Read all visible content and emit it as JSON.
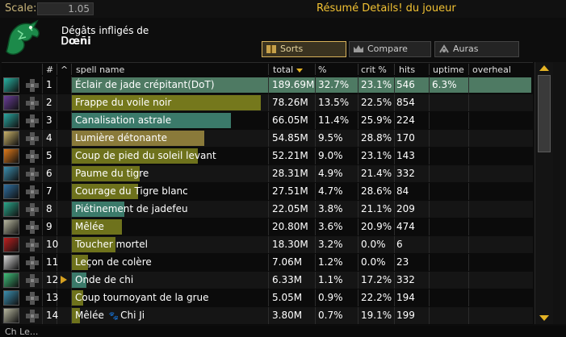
{
  "topbar": {
    "scale_label": "Scale:",
    "scale_value": "1.05",
    "title": "Résumé Details! du joueur"
  },
  "header": {
    "damage_label": "Dégâts infligés de",
    "player_name": "Ꭰœñi"
  },
  "tabs": [
    {
      "label": "Sorts",
      "active": true
    },
    {
      "label": "Compare",
      "active": false
    },
    {
      "label": "Auras",
      "active": false
    }
  ],
  "columns": {
    "num": "#",
    "sort": "^",
    "spell": "spell name",
    "total": "total",
    "pct": "%",
    "crit": "crit %",
    "hits": "hits",
    "uptime": "uptime",
    "overheal": "overheal"
  },
  "rows": [
    {
      "rank": "1",
      "name": "Éclair de jade crépitant(DoT)",
      "total": "189.69M",
      "pct": "32.7%",
      "crit": "23.1%",
      "hits": "546",
      "uptime": "6.3%",
      "bar_fraction": 1.0,
      "bar_color": "#4e7a63",
      "icon_color": "#27b3a3",
      "expandable": false,
      "pet": ""
    },
    {
      "rank": "2",
      "name": "Frappe du voile noir",
      "total": "78.26M",
      "pct": "13.5%",
      "crit": "22.5%",
      "hits": "854",
      "uptime": "",
      "bar_fraction": 0.413,
      "bar_color": "#75781c",
      "icon_color": "#6b3e9a",
      "expandable": false,
      "pet": ""
    },
    {
      "rank": "3",
      "name": "Canalisation astrale",
      "total": "66.05M",
      "pct": "11.4%",
      "crit": "25.9%",
      "hits": "224",
      "uptime": "",
      "bar_fraction": 0.348,
      "bar_color": "#3b7a6a",
      "icon_color": "#2aa7a0",
      "expandable": false,
      "pet": ""
    },
    {
      "rank": "4",
      "name": "Lumière détonante",
      "total": "54.85M",
      "pct": "9.5%",
      "crit": "28.8%",
      "hits": "170",
      "uptime": "",
      "bar_fraction": 0.289,
      "bar_color": "#8a7a3a",
      "icon_color": "#c9b26a",
      "expandable": false,
      "pet": ""
    },
    {
      "rank": "5",
      "name": "Coup de pied du soleil levant",
      "total": "52.21M",
      "pct": "9.0%",
      "crit": "23.1%",
      "hits": "143",
      "uptime": "",
      "bar_fraction": 0.275,
      "bar_color": "#6e721c",
      "icon_color": "#e07a1a",
      "expandable": false,
      "pet": ""
    },
    {
      "rank": "6",
      "name": "Paume du tigre",
      "total": "28.31M",
      "pct": "4.9%",
      "crit": "21.4%",
      "hits": "332",
      "uptime": "",
      "bar_fraction": 0.149,
      "bar_color": "#6e721c",
      "icon_color": "#3b8fb0",
      "expandable": false,
      "pet": ""
    },
    {
      "rank": "7",
      "name": "Courage du Tigre blanc",
      "total": "27.51M",
      "pct": "4.7%",
      "crit": "28.6%",
      "hits": "84",
      "uptime": "",
      "bar_fraction": 0.145,
      "bar_color": "#6e721c",
      "icon_color": "#2f6fa0",
      "expandable": false,
      "pet": ""
    },
    {
      "rank": "8",
      "name": "Piétinement de jadefeu",
      "total": "22.05M",
      "pct": "3.8%",
      "crit": "21.1%",
      "hits": "209",
      "uptime": "",
      "bar_fraction": 0.116,
      "bar_color": "#3b7a6a",
      "icon_color": "#2aa78a",
      "expandable": false,
      "pet": ""
    },
    {
      "rank": "9",
      "name": "Mêlée",
      "total": "20.80M",
      "pct": "3.6%",
      "crit": "20.9%",
      "hits": "474",
      "uptime": "",
      "bar_fraction": 0.11,
      "bar_color": "#6e721c",
      "icon_color": "#b8b8a0",
      "expandable": false,
      "pet": ""
    },
    {
      "rank": "10",
      "name": "Toucher mortel",
      "total": "18.30M",
      "pct": "3.2%",
      "crit": "0.0%",
      "hits": "6",
      "uptime": "",
      "bar_fraction": 0.096,
      "bar_color": "#6e721c",
      "icon_color": "#c02020",
      "expandable": false,
      "pet": ""
    },
    {
      "rank": "11",
      "name": "Leçon de colère",
      "total": "7.06M",
      "pct": "1.2%",
      "crit": "0.0%",
      "hits": "23",
      "uptime": "",
      "bar_fraction": 0.037,
      "bar_color": "#6e721c",
      "icon_color": "#d9d9d9",
      "expandable": false,
      "pet": ""
    },
    {
      "rank": "12",
      "name": "Onde de chi",
      "total": "6.33M",
      "pct": "1.1%",
      "crit": "17.2%",
      "hits": "332",
      "uptime": "",
      "bar_fraction": 0.033,
      "bar_color": "#3b7a6a",
      "icon_color": "#3fbf7a",
      "expandable": true,
      "pet": ""
    },
    {
      "rank": "13",
      "name": "Coup tournoyant de la grue",
      "total": "5.05M",
      "pct": "0.9%",
      "crit": "22.2%",
      "hits": "194",
      "uptime": "",
      "bar_fraction": 0.027,
      "bar_color": "#6e721c",
      "icon_color": "#3b8fb0",
      "expandable": false,
      "pet": ""
    },
    {
      "rank": "14",
      "name": "Mêlée",
      "total": "3.80M",
      "pct": "0.7%",
      "crit": "19.1%",
      "hits": "199",
      "uptime": "",
      "bar_fraction": 0.02,
      "bar_color": "#6e721c",
      "icon_color": "#b8b8a0",
      "expandable": false,
      "pet": "Chi Ji"
    }
  ],
  "bottom": {
    "text": "Ch Le..."
  },
  "colors": {
    "accent_gold": "#f2c233",
    "row_stripe": "#151515"
  }
}
